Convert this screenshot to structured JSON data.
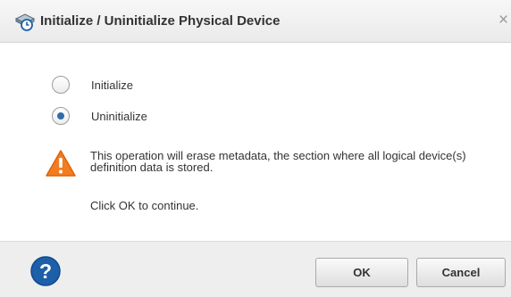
{
  "dialog": {
    "title": "Initialize / Uninitialize Physical Device",
    "close_glyph": "×",
    "title_icon": "physical-device-icon"
  },
  "options": {
    "selected": "Uninitialize",
    "items": [
      {
        "label": "Initialize",
        "checked": false
      },
      {
        "label": "Uninitialize",
        "checked": true
      }
    ]
  },
  "warning": {
    "icon": "warning-icon",
    "message": "This operation will erase metadata, the section where all logical device(s) definition data is stored.",
    "instruction": "Click OK to continue."
  },
  "footer": {
    "help_icon": "help-icon",
    "ok_label": "OK",
    "cancel_label": "Cancel"
  },
  "colors": {
    "accent": "#2f6ea8",
    "warning": "#f47c20",
    "help": "#1d5fa8",
    "footer_bg": "#eeeeee"
  }
}
